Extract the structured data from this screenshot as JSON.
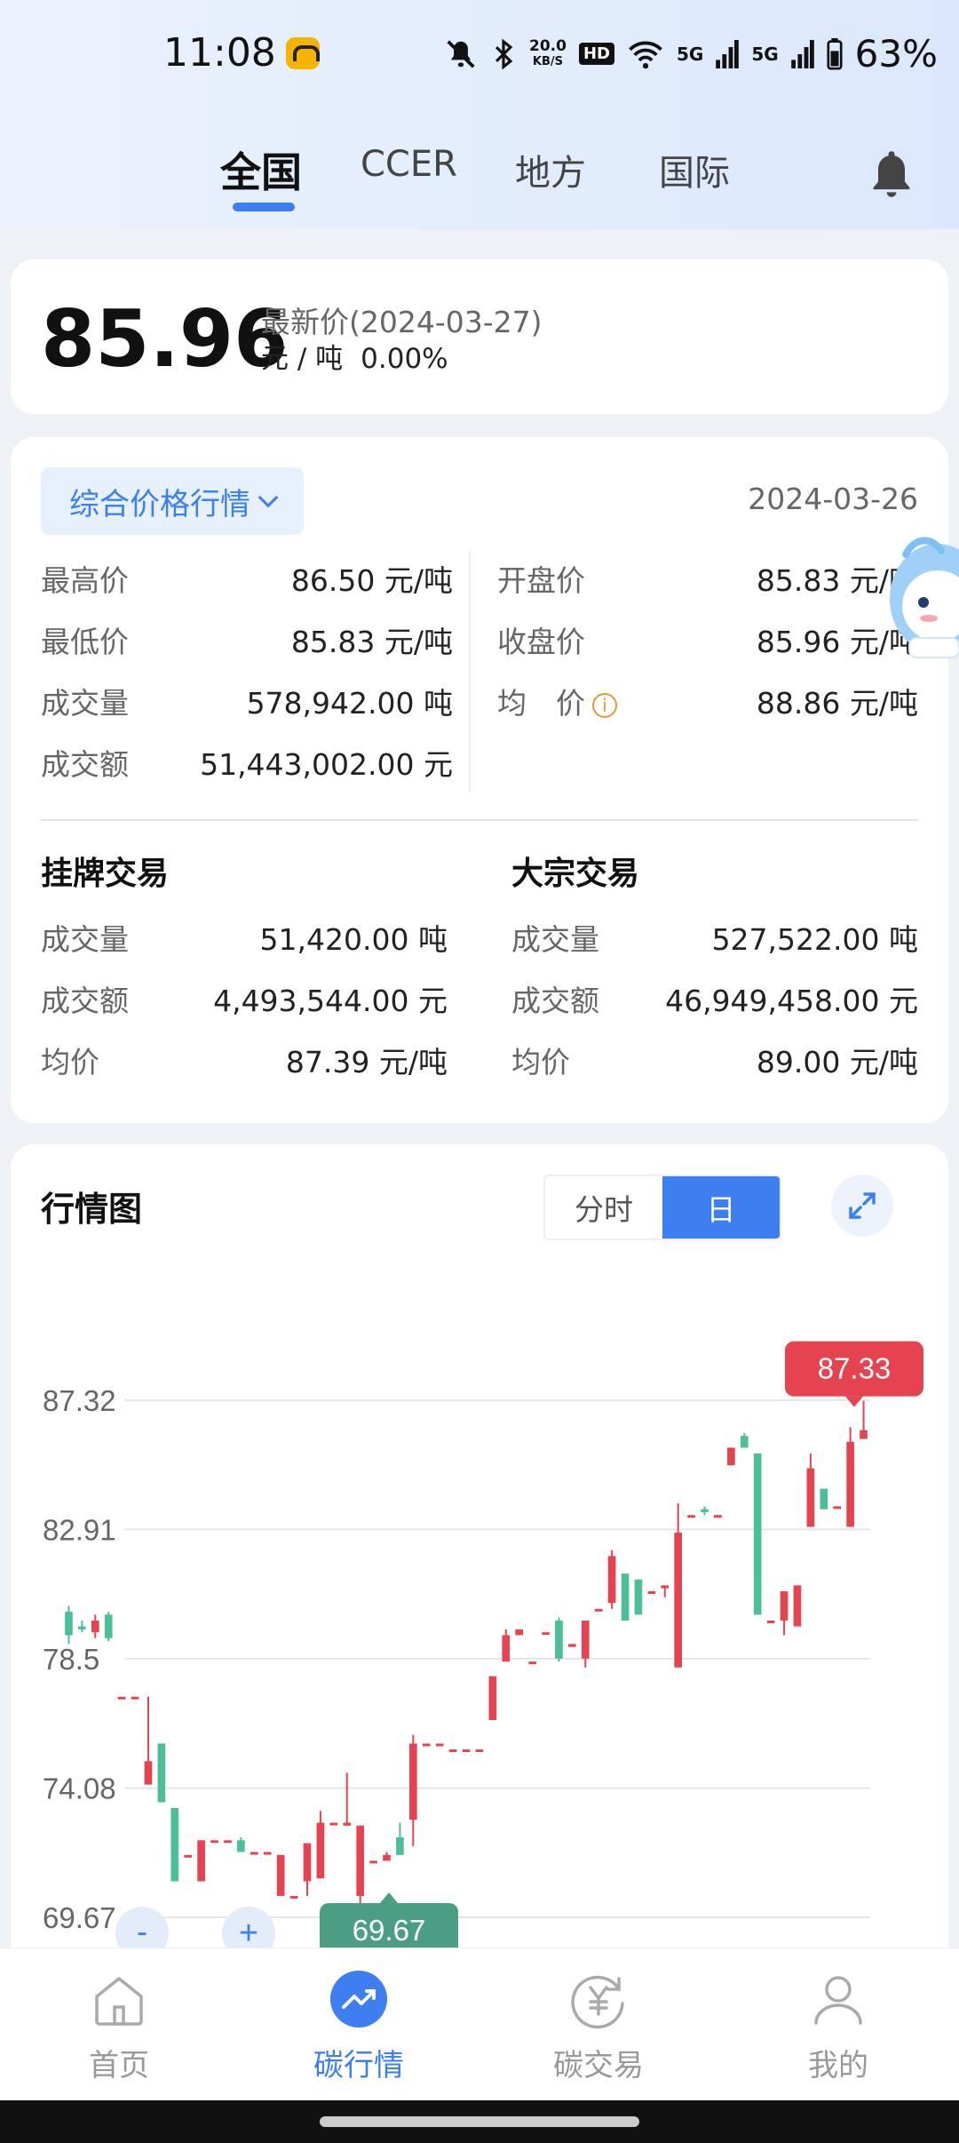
{
  "status": {
    "time": "11:08",
    "net_speed_top": "20.0",
    "net_speed_unit": "KB/S",
    "hd": "HD",
    "sig1": "5G",
    "sig2": "5G",
    "battery": "63%"
  },
  "tabs": [
    "全国",
    "CCER",
    "地方",
    "国际"
  ],
  "price": {
    "value": "85.96",
    "label": "最新价(2024-03-27)",
    "unit": "元 / 吨",
    "change": "0.00%"
  },
  "market": {
    "dropdown_label": "综合价格行情",
    "date": "2024-03-26",
    "left": [
      {
        "k": "最高价",
        "v": "86.50 元/吨"
      },
      {
        "k": "最低价",
        "v": "85.83 元/吨"
      },
      {
        "k": "成交量",
        "v": "578,942.00 吨"
      },
      {
        "k": "成交额",
        "v": "51,443,002.00 元"
      }
    ],
    "right": [
      {
        "k": "开盘价",
        "v": "85.83 元/吨"
      },
      {
        "k": "收盘价",
        "v": "85.96 元/吨"
      },
      {
        "k": "均　价",
        "v": "88.86 元/吨"
      }
    ],
    "listed_title": "挂牌交易",
    "listed": [
      {
        "k": "成交量",
        "v": "51,420.00 吨"
      },
      {
        "k": "成交额",
        "v": "4,493,544.00 元"
      },
      {
        "k": "均价",
        "v": "87.39 元/吨"
      }
    ],
    "bulk_title": "大宗交易",
    "bulk": [
      {
        "k": "成交量",
        "v": "527,522.00 吨"
      },
      {
        "k": "成交额",
        "v": "46,949,458.00 元"
      },
      {
        "k": "均价",
        "v": "89.00 元/吨"
      }
    ]
  },
  "chart_section": {
    "title": "行情图",
    "seg_intraday": "分时",
    "seg_daily": "日",
    "zoom_out": "-",
    "zoom_in": "+"
  },
  "chart_data": {
    "type": "candlestick",
    "y_ticks": [
      "87.32",
      "82.91",
      "78.5",
      "74.08",
      "69.67"
    ],
    "ylim": [
      69.67,
      87.32
    ],
    "max_label": "87.33",
    "min_label": "69.67",
    "colors": {
      "up": "#e5434f",
      "down": "#4cbf98"
    },
    "candles": [
      [
        80.1,
        79.3,
        80.3,
        79.0
      ],
      [
        79.6,
        79.5,
        79.8,
        79.4
      ],
      [
        79.4,
        79.8,
        80.0,
        79.2
      ],
      [
        80.0,
        79.2,
        80.1,
        79.1
      ],
      [
        77.2,
        77.2,
        77.2,
        77.2
      ],
      [
        77.2,
        77.2,
        77.2,
        77.2
      ],
      [
        74.2,
        75.0,
        77.2,
        74.2
      ],
      [
        75.6,
        73.6,
        75.6,
        73.6
      ],
      [
        73.4,
        70.9,
        73.4,
        70.9
      ],
      [
        71.8,
        71.8,
        71.8,
        71.8
      ],
      [
        70.9,
        72.3,
        72.3,
        70.9
      ],
      [
        72.3,
        72.3,
        72.3,
        72.3
      ],
      [
        72.3,
        72.3,
        72.3,
        72.3
      ],
      [
        72.3,
        71.9,
        72.4,
        71.9
      ],
      [
        71.9,
        71.9,
        71.9,
        71.9
      ],
      [
        71.9,
        71.9,
        71.9,
        71.9
      ],
      [
        70.4,
        71.8,
        71.8,
        70.4
      ],
      [
        70.4,
        70.4,
        70.4,
        70.4
      ],
      [
        70.9,
        72.2,
        72.2,
        70.4
      ],
      [
        71.0,
        72.9,
        73.3,
        71.0
      ],
      [
        72.9,
        72.9,
        72.9,
        72.9
      ],
      [
        72.8,
        72.9,
        74.6,
        72.8
      ],
      [
        70.4,
        72.8,
        72.8,
        69.7
      ],
      [
        71.6,
        71.6,
        71.6,
        71.6
      ],
      [
        71.6,
        71.8,
        71.9,
        71.6
      ],
      [
        72.4,
        71.8,
        72.9,
        71.8
      ],
      [
        73.0,
        75.6,
        75.9,
        72.1
      ],
      [
        75.6,
        75.6,
        75.6,
        75.6
      ],
      [
        75.6,
        75.6,
        75.6,
        75.6
      ],
      [
        75.4,
        75.4,
        75.4,
        75.4
      ],
      [
        75.4,
        75.4,
        75.4,
        75.4
      ],
      [
        75.4,
        75.4,
        75.4,
        75.4
      ],
      [
        76.4,
        77.9,
        77.9,
        76.4
      ],
      [
        78.4,
        79.3,
        79.5,
        78.4
      ],
      [
        79.3,
        79.5,
        79.5,
        79.3
      ],
      [
        78.4,
        78.4,
        78.4,
        78.4
      ],
      [
        79.4,
        79.4,
        79.4,
        79.4
      ],
      [
        79.8,
        78.5,
        79.9,
        78.4
      ],
      [
        78.9,
        79.0,
        79.0,
        78.9
      ],
      [
        78.5,
        79.8,
        79.8,
        78.2
      ],
      [
        80.2,
        80.2,
        80.2,
        80.2
      ],
      [
        80.4,
        82.0,
        82.2,
        80.2
      ],
      [
        81.4,
        79.8,
        81.4,
        79.8
      ],
      [
        81.2,
        80.0,
        81.2,
        80.0
      ],
      [
        80.8,
        80.8,
        80.8,
        80.8
      ],
      [
        80.9,
        81.0,
        81.0,
        80.6
      ],
      [
        78.2,
        82.8,
        83.8,
        78.2
      ],
      [
        83.4,
        83.4,
        83.4,
        83.4
      ],
      [
        83.6,
        83.5,
        83.7,
        83.4
      ],
      [
        83.4,
        83.4,
        83.4,
        83.4
      ],
      [
        85.1,
        85.7,
        85.7,
        85.1
      ],
      [
        86.1,
        85.7,
        86.2,
        85.7
      ],
      [
        85.5,
        80.0,
        85.5,
        80.0
      ],
      [
        79.8,
        79.8,
        79.8,
        79.8
      ],
      [
        79.8,
        80.8,
        80.8,
        79.3
      ],
      [
        79.6,
        81.0,
        81.0,
        79.6
      ],
      [
        83.0,
        85.0,
        85.5,
        83.0
      ],
      [
        84.3,
        83.6,
        84.3,
        83.6
      ],
      [
        83.7,
        83.7,
        83.7,
        83.7
      ],
      [
        83.0,
        85.9,
        86.4,
        83.0
      ],
      [
        86.0,
        86.3,
        87.3,
        86.0
      ]
    ]
  },
  "bottom_nav": [
    {
      "label": "首页",
      "icon": "home-icon"
    },
    {
      "label": "碳行情",
      "icon": "trend-icon"
    },
    {
      "label": "碳交易",
      "icon": "yuan-exchange-icon"
    },
    {
      "label": "我的",
      "icon": "user-icon"
    }
  ]
}
